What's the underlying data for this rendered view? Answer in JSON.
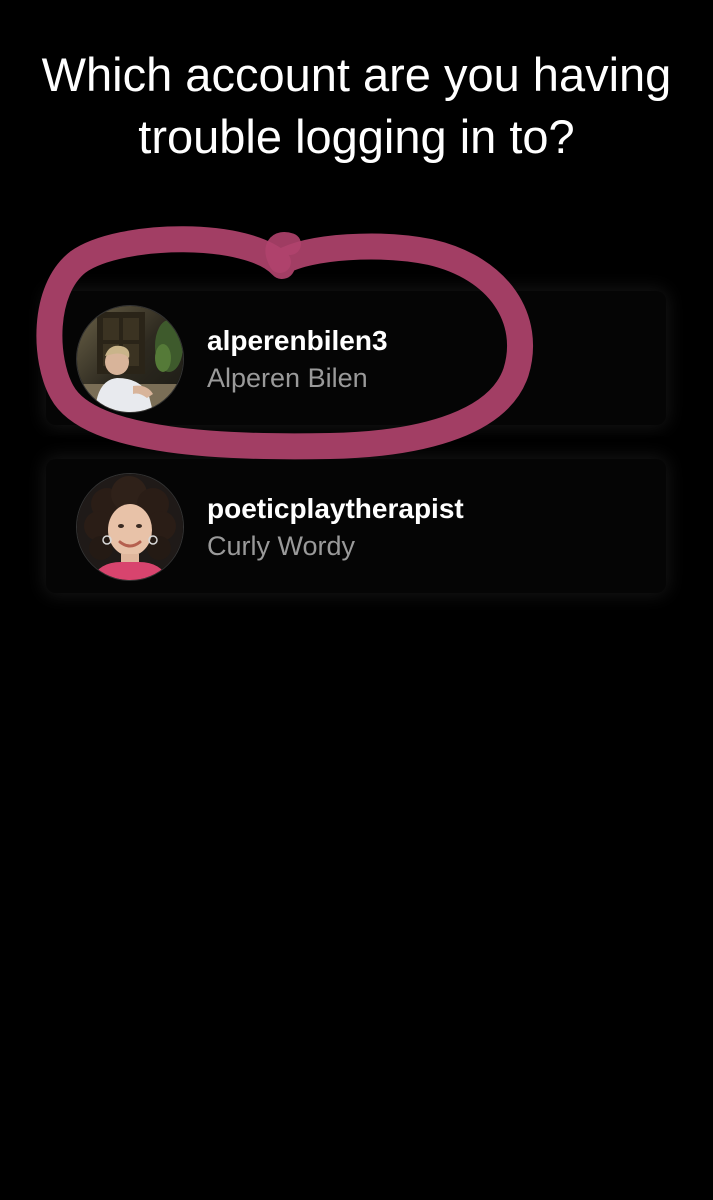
{
  "header": {
    "title": "Which account are you having trouble logging in to?",
    "back_icon": "chevron-left-icon"
  },
  "accounts": [
    {
      "username": "alperenbilen3",
      "full_name": "Alperen Bilen",
      "highlighted": true
    },
    {
      "username": "poeticplaytherapist",
      "full_name": "Curly Wordy",
      "highlighted": false
    }
  ],
  "colors": {
    "background": "#000000",
    "card": "#050505",
    "primary_text": "#ffffff",
    "secondary_text": "#9a9a9a",
    "annotation_marker": "#b0436d"
  }
}
